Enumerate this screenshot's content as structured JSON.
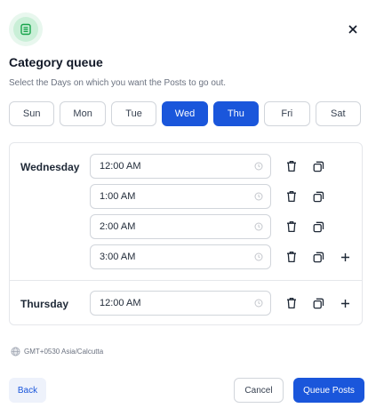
{
  "modal": {
    "title": "Category queue",
    "subtitle": "Select the Days on which you want the Posts to go out."
  },
  "days": [
    {
      "label": "Sun",
      "selected": false
    },
    {
      "label": "Mon",
      "selected": false
    },
    {
      "label": "Tue",
      "selected": false
    },
    {
      "label": "Wed",
      "selected": true
    },
    {
      "label": "Thu",
      "selected": true
    },
    {
      "label": "Fri",
      "selected": false
    },
    {
      "label": "Sat",
      "selected": false
    }
  ],
  "schedule": {
    "wednesday": {
      "label": "Wednesday",
      "times": [
        "12:00 AM",
        "1:00 AM",
        "2:00 AM",
        "3:00 AM"
      ]
    },
    "thursday": {
      "label": "Thursday",
      "times": [
        "12:00 AM"
      ]
    }
  },
  "timezone": "GMT+0530 Asia/Calcutta",
  "footer": {
    "back_label": "Back",
    "cancel_label": "Cancel",
    "queue_label": "Queue Posts"
  },
  "colors": {
    "accent": "#1a56db",
    "icon_green": "#16a34a"
  }
}
